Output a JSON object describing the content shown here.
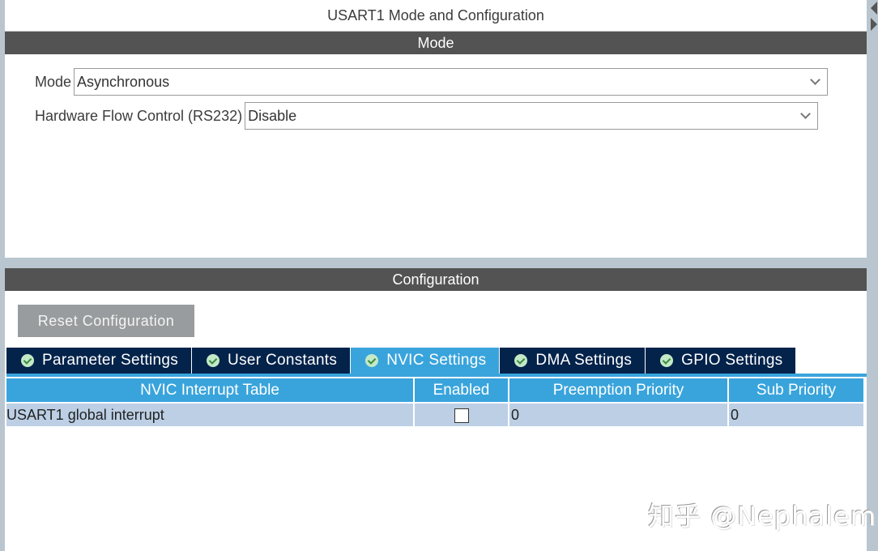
{
  "window": {
    "title": "USART1 Mode and Configuration"
  },
  "mode_section": {
    "header": "Mode",
    "fields": [
      {
        "label": "Mode",
        "value": "Asynchronous"
      },
      {
        "label": "Hardware Flow Control (RS232)",
        "value": "Disable"
      }
    ]
  },
  "config_section": {
    "header": "Configuration",
    "reset_button": "Reset Configuration",
    "tabs": [
      {
        "label": "Parameter Settings",
        "icon": "check-circle-icon",
        "active": false
      },
      {
        "label": "User Constants",
        "icon": "check-circle-icon",
        "active": false
      },
      {
        "label": "NVIC Settings",
        "icon": "check-circle-icon",
        "active": true
      },
      {
        "label": "DMA Settings",
        "icon": "check-circle-icon",
        "active": false
      },
      {
        "label": "GPIO Settings",
        "icon": "check-circle-icon",
        "active": false
      }
    ],
    "table": {
      "columns": [
        "NVIC Interrupt Table",
        "Enabled",
        "Preemption Priority",
        "Sub Priority"
      ],
      "rows": [
        {
          "name": "USART1 global interrupt",
          "enabled": false,
          "preemption_priority": "0",
          "sub_priority": "0"
        }
      ]
    }
  },
  "watermark": "知乎 @Nephalem",
  "colors": {
    "section_bar": "#525352",
    "tab_dark": "#03234b",
    "tab_active": "#39a4dc",
    "row_bg": "#bccfe5"
  }
}
